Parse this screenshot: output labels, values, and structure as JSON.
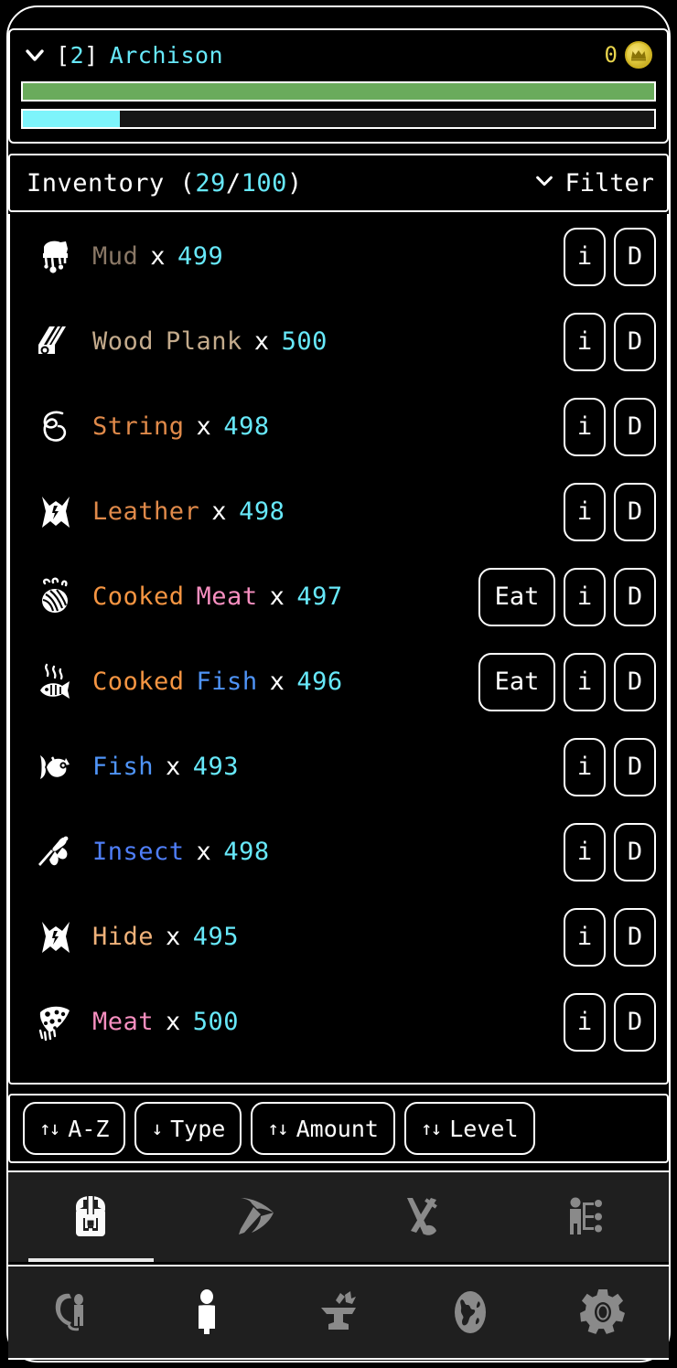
{
  "player": {
    "collapse_icon": "chevron-down-icon",
    "level_open": "[",
    "level": "2",
    "level_close": "]",
    "name": "Archison",
    "coin_count": "0",
    "coin_icon": "gold-coin-icon",
    "health_percent": 100,
    "xp_percent": 15.3,
    "health_color": "#6aab5c",
    "xp_color": "#7df4fb"
  },
  "inventory": {
    "title_prefix": "Inventory (",
    "used": "29",
    "slash": "/",
    "capacity": "100",
    "title_suffix": ")",
    "filter_label": "Filter",
    "filter_icon": "chevron-down-icon",
    "info_button": "i",
    "drop_button": "D",
    "eat_button": "Eat",
    "items": [
      {
        "icon": "mud-icon",
        "name_parts": [
          {
            "text": "Mud",
            "color": "#8a7866"
          }
        ],
        "x": "x",
        "qty": "499",
        "eat": false
      },
      {
        "icon": "wood-plank-icon",
        "name_parts": [
          {
            "text": "Wood",
            "color": "#c4ab8c"
          },
          {
            "text": "Plank",
            "color": "#c4ab8c"
          }
        ],
        "x": "x",
        "qty": "500",
        "eat": false
      },
      {
        "icon": "string-icon",
        "name_parts": [
          {
            "text": "String",
            "color": "#e08a4a"
          }
        ],
        "x": "x",
        "qty": "498",
        "eat": false
      },
      {
        "icon": "leather-icon",
        "name_parts": [
          {
            "text": "Leather",
            "color": "#e08a4a"
          }
        ],
        "x": "x",
        "qty": "498",
        "eat": false
      },
      {
        "icon": "cooked-meat-icon",
        "name_parts": [
          {
            "text": "Cooked",
            "color": "#f59542"
          },
          {
            "text": "Meat",
            "color": "#f78fc0"
          }
        ],
        "x": "x",
        "qty": "497",
        "eat": true
      },
      {
        "icon": "cooked-fish-icon",
        "name_parts": [
          {
            "text": "Cooked",
            "color": "#f59542"
          },
          {
            "text": "Fish",
            "color": "#4f94f7"
          }
        ],
        "x": "x",
        "qty": "496",
        "eat": true
      },
      {
        "icon": "fish-icon",
        "name_parts": [
          {
            "text": "Fish",
            "color": "#4f94f7"
          }
        ],
        "x": "x",
        "qty": "493",
        "eat": false
      },
      {
        "icon": "insect-icon",
        "name_parts": [
          {
            "text": "Insect",
            "color": "#4f7ef7"
          }
        ],
        "x": "x",
        "qty": "498",
        "eat": false
      },
      {
        "icon": "hide-icon",
        "name_parts": [
          {
            "text": "Hide",
            "color": "#f0b27a"
          }
        ],
        "x": "x",
        "qty": "495",
        "eat": false
      },
      {
        "icon": "meat-icon",
        "name_parts": [
          {
            "text": "Meat",
            "color": "#f78fc0"
          }
        ],
        "x": "x",
        "qty": "500",
        "eat": false
      }
    ]
  },
  "sort": {
    "buttons": [
      {
        "arrows": "↑↓",
        "label": "A-Z"
      },
      {
        "arrows": "↓",
        "label": "Type"
      },
      {
        "arrows": "↑↓",
        "label": "Amount"
      },
      {
        "arrows": "↑↓",
        "label": "Level"
      }
    ]
  },
  "tabs": [
    {
      "icon": "backpack-icon",
      "name": "tab-inventory",
      "active": true
    },
    {
      "icon": "pickaxe-icon",
      "name": "tab-gathering",
      "active": false
    },
    {
      "icon": "crossed-tools-icon",
      "name": "tab-equipment",
      "active": false
    },
    {
      "icon": "skill-tree-icon",
      "name": "tab-skills",
      "active": false
    }
  ],
  "bottom_nav": [
    {
      "icon": "creature-icon",
      "name": "nav-creatures",
      "active": false
    },
    {
      "icon": "person-icon",
      "name": "nav-character",
      "active": true
    },
    {
      "icon": "anvil-icon",
      "name": "nav-crafting",
      "active": false
    },
    {
      "icon": "globe-icon",
      "name": "nav-world",
      "active": false
    },
    {
      "icon": "gear-icon",
      "name": "nav-settings",
      "active": false
    }
  ]
}
